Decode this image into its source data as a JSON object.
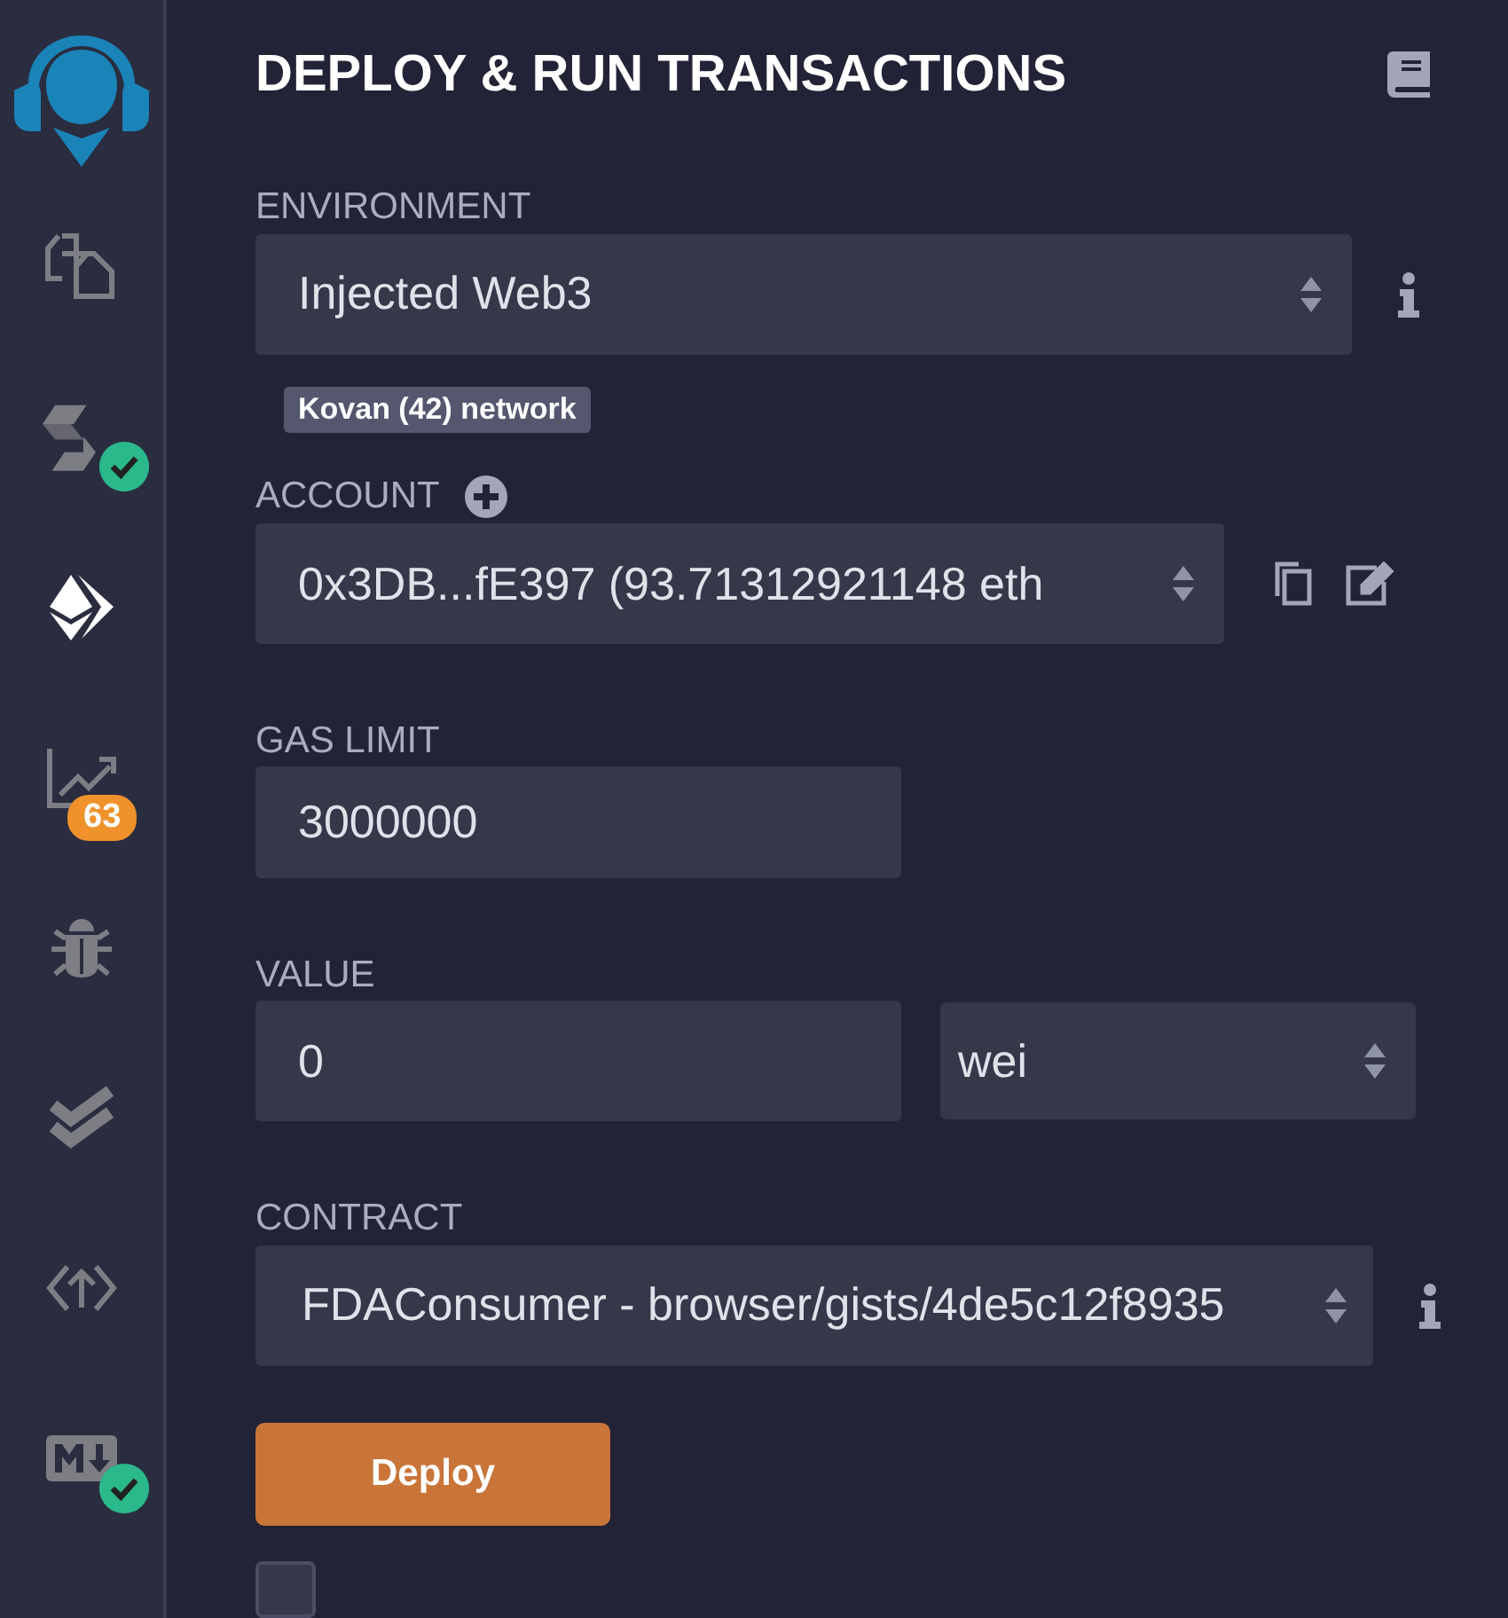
{
  "sidebar": {
    "items": [
      {
        "kind": "files",
        "selected": false,
        "check": false
      },
      {
        "kind": "compiler",
        "selected": false,
        "check": true
      },
      {
        "kind": "deploy",
        "selected": true,
        "check": false
      },
      {
        "kind": "analysis",
        "selected": false,
        "check": false,
        "badge": "63"
      },
      {
        "kind": "debugger",
        "selected": false,
        "check": false
      },
      {
        "kind": "tests",
        "selected": false,
        "check": false
      },
      {
        "kind": "publish",
        "selected": false,
        "check": false
      },
      {
        "kind": "markdown",
        "selected": false,
        "check": true
      }
    ]
  },
  "panel": {
    "title": "DEPLOY & RUN TRANSACTIONS",
    "environment": {
      "label": "ENVIRONMENT",
      "value": "Injected Web3",
      "network": "Kovan (42) network"
    },
    "account": {
      "label": "ACCOUNT",
      "value": "0x3DB...fE397 (93.71312921148 eth"
    },
    "gas_limit": {
      "label": "GAS LIMIT",
      "value": "3000000"
    },
    "value": {
      "label": "VALUE",
      "value": "0",
      "unit": "wei"
    },
    "contract": {
      "label": "CONTRACT",
      "value": "FDAConsumer - browser/gists/4de5c12f8935"
    },
    "deploy_button": "Deploy",
    "publish_checkbox": {
      "checked": false
    }
  }
}
